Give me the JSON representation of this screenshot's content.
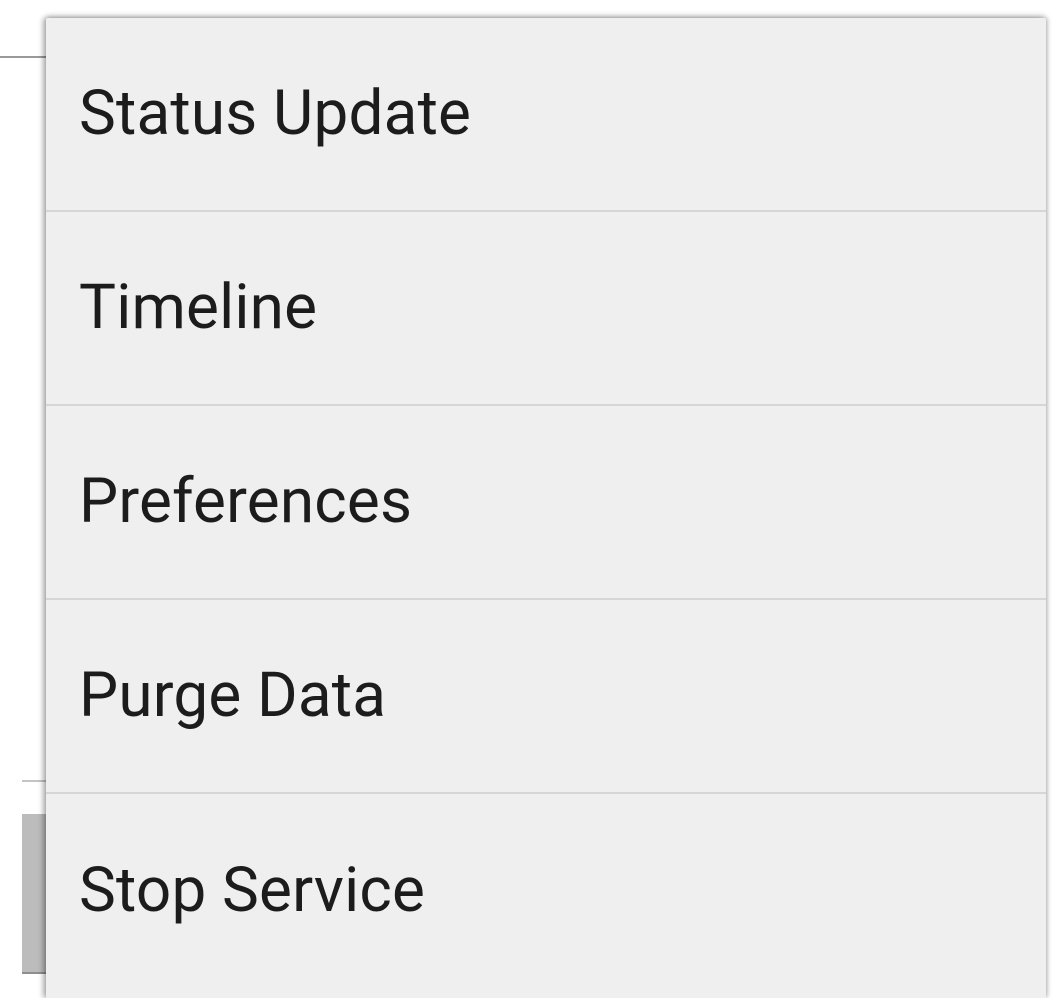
{
  "menu": {
    "items": [
      {
        "label": "Status Update"
      },
      {
        "label": "Timeline"
      },
      {
        "label": "Preferences"
      },
      {
        "label": "Purge Data"
      },
      {
        "label": "Stop Service"
      }
    ]
  }
}
